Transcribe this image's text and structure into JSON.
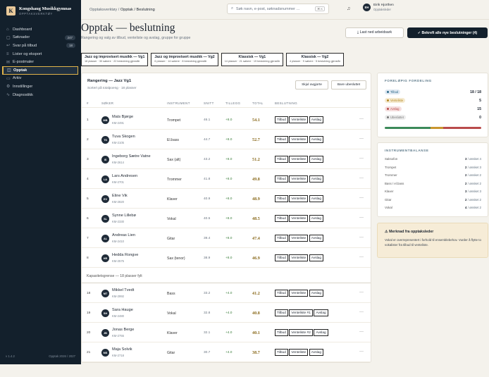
{
  "app": {
    "name": "Kongshaug Musikkgymnas",
    "sub": "OPPTAKSVERKTØY",
    "logo": "K",
    "version": "v 1.4.2",
    "period": "Opptak 2026 / 2027"
  },
  "nav": [
    {
      "icon": "⌂",
      "label": "Dashboard",
      "count": ""
    },
    {
      "icon": "▢",
      "label": "Søknader",
      "count": "247"
    },
    {
      "icon": "↩",
      "label": "Svar på tilbud",
      "count": "18"
    },
    {
      "icon": "≡",
      "label": "Lister og eksport",
      "count": ""
    },
    {
      "icon": "✉",
      "label": "E-postmaler",
      "count": ""
    },
    {
      "icon": "◫",
      "label": "Opptak",
      "count": ""
    },
    {
      "icon": "▭",
      "label": "Arkiv",
      "count": ""
    },
    {
      "icon": "⚙",
      "label": "Innstillinger",
      "count": ""
    },
    {
      "icon": "∿",
      "label": "Diagnostikk",
      "count": ""
    }
  ],
  "breadcrumb": {
    "parent": "Opptaksverktøy",
    "sep": "/",
    "current": "Opptak / Beslutning"
  },
  "search": {
    "placeholder": "Søk navn, e-post, søknadsnummer …",
    "shortcut": "⌘ K"
  },
  "user": {
    "initials": "EH",
    "name": "Eirik Hjorthen",
    "role": "Opptaksleder"
  },
  "page": {
    "title": "Opptak — beslutning",
    "subtitle": "Rangering og valg av tilbud, venteliste og avslag, gruppe for gruppe"
  },
  "actions": {
    "download": "⤓  Last ned arbeidsark",
    "confirm": "✓  Bekreft alle nye beslutninger (4)"
  },
  "tabs": [
    {
      "title": "Jazz og improvisert musikk — Vg1",
      "sub": "18 plasser · 30 søkere · 22 beslutning gjenstår"
    },
    {
      "title": "Jazz og improvisert musikk — Vg2",
      "sub": "6 plasser · 14 søkere · 8 beslutning gjenstår"
    },
    {
      "title": "Klassisk — Vg1",
      "sub": "14 plasser · 21 søkere · 19 beslutning gjenstår"
    },
    {
      "title": "Klassisk — Vg2",
      "sub": "4 plasser · 9 søkere · 5 beslutning gjenstår"
    }
  ],
  "ranking": {
    "title": "Rangering — Jazz Vg1",
    "sub": "Sortert på totalpoeng · 18 plasser",
    "hide_label": "Skjul avgjorte",
    "only_label": "Bare ubesluttet",
    "columns": {
      "num": "#",
      "applicant": "SØKER",
      "instrument": "INSTRUMENT",
      "avg": "SNITT",
      "bonus": "TILLEGG",
      "total": "TOTAL",
      "decision": "BESLUTNING"
    },
    "capacity_label": "Kapasitetsgrense — 18 plasser fylt",
    "rows": [
      {
        "n": "1",
        "ini": "MB",
        "name": "Mats Bjørge",
        "id": "KM-2491",
        "instrument": "Trompet",
        "avg": "46.1",
        "bonus": "+8.0",
        "total": "54.1",
        "b1": "Tilbud",
        "b2": "Venteliste",
        "b3": "Avslag"
      },
      {
        "n": "2",
        "ini": "TS",
        "name": "Tuva Skogen",
        "id": "KM-2105",
        "instrument": "El.bass",
        "avg": "44.7",
        "bonus": "+8.0",
        "total": "52.7",
        "b1": "Tilbud",
        "b2": "Venteliste",
        "b3": "Avslag"
      },
      {
        "n": "3",
        "ini": "IS",
        "name": "Ingeborg Sætre Vatne",
        "id": "KM-2614",
        "instrument": "Sax (alt)",
        "avg": "43.2",
        "bonus": "+8.0",
        "total": "51.2",
        "b1": "Tilbud",
        "b2": "Venteliste",
        "b3": "Avslag"
      },
      {
        "n": "4",
        "ini": "LA",
        "name": "Lars Andresen",
        "id": "KM-2701",
        "instrument": "Trommer",
        "avg": "41.8",
        "bonus": "+8.0",
        "total": "49.8",
        "b1": "Tilbud",
        "b2": "Venteliste",
        "b3": "Avslag"
      },
      {
        "n": "5",
        "ini": "EV",
        "name": "Eline Vik",
        "id": "KM-2820",
        "instrument": "Klaver",
        "avg": "40.9",
        "bonus": "+8.0",
        "total": "48.9",
        "b1": "Tilbud",
        "b2": "Venteliste",
        "b3": "Avslag"
      },
      {
        "n": "6",
        "ini": "SL",
        "name": "Synne Lillebø",
        "id": "KM-2330",
        "instrument": "Vokal",
        "avg": "40.5",
        "bonus": "+8.0",
        "total": "48.5",
        "b1": "Tilbud",
        "b2": "Venteliste",
        "b3": "Avslag"
      },
      {
        "n": "7",
        "ini": "AL",
        "name": "Andreas Lien",
        "id": "KM-2410",
        "instrument": "Gitar",
        "avg": "39.4",
        "bonus": "+8.0",
        "total": "47.4",
        "b1": "Tilbud",
        "b2": "Venteliste",
        "b3": "Avslag"
      },
      {
        "n": "8",
        "ini": "HR",
        "name": "Hedda Rongve",
        "id": "KM-2575",
        "instrument": "Sax (tenor)",
        "avg": "38.9",
        "bonus": "+8.0",
        "total": "46.9",
        "b1": "Tilbud",
        "b2": "Venteliste",
        "b3": "Avslag"
      },
      {
        "n": "18",
        "ini": "MT",
        "name": "Mikkel Tvedt",
        "id": "KM-2992",
        "instrument": "Bass",
        "avg": "33.2",
        "bonus": "+4.0",
        "total": "41.2",
        "b1": "Tilbud",
        "b2": "Venteliste",
        "b3": "Avslag"
      },
      {
        "n": "19",
        "ini": "SH",
        "name": "Sara Hauge",
        "id": "KM-2480",
        "instrument": "Vokal",
        "avg": "32.8",
        "bonus": "+4.0",
        "total": "40.8",
        "b1": "Tilbud",
        "b2": "Venteliste #1",
        "b3": "Avslag"
      },
      {
        "n": "20",
        "ini": "JB",
        "name": "Jonas Berge",
        "id": "KM-2755",
        "instrument": "Klaver",
        "avg": "32.1",
        "bonus": "+4.0",
        "total": "40.1",
        "b1": "Tilbud",
        "b2": "Venteliste #2",
        "b3": "Avslag"
      },
      {
        "n": "21",
        "ini": "MS",
        "name": "Maja Solvik",
        "id": "KM-2718",
        "instrument": "Gitar",
        "avg": "30.7",
        "bonus": "+4.0",
        "total": "38.7",
        "b1": "Tilbud",
        "b2": "Venteliste",
        "b3": "Avslag"
      }
    ]
  },
  "distribution": {
    "title": "FORELØPIG FORDELING",
    "items": [
      {
        "label": "Tilbud",
        "value": "18 / 18",
        "bg": "#dfe8f2",
        "color": "#2d6b8a",
        "amount": 18
      },
      {
        "label": "Venteliste",
        "value": "5",
        "bg": "#f5ead0",
        "color": "#b58a25",
        "amount": 5
      },
      {
        "label": "Avslag",
        "value": "15",
        "bg": "#f5dede",
        "color": "#b94b4b",
        "amount": 15
      },
      {
        "label": "Ubesluttet",
        "value": "0",
        "bg": "#ececec",
        "color": "#777777",
        "amount": 0
      }
    ],
    "bar_colors": [
      "#3c8a5a",
      "#c9962f",
      "#b94b4b"
    ]
  },
  "balance": {
    "title": "INSTRUMENTBALANSE",
    "items": [
      {
        "instrument": "Saksofon",
        "count": "3",
        "wish": "/ ønsket 4"
      },
      {
        "instrument": "Trompet",
        "count": "2",
        "wish": "/ ønsket 3"
      },
      {
        "instrument": "Trommer",
        "count": "2",
        "wish": "/ ønsket 2"
      },
      {
        "instrument": "Bass / el.bass",
        "count": "2",
        "wish": "/ ønsket 2"
      },
      {
        "instrument": "Klaver",
        "count": "3",
        "wish": "/ ønsket 3"
      },
      {
        "instrument": "Gitar",
        "count": "2",
        "wish": "/ ønsket 2"
      },
      {
        "instrument": "Vokal",
        "count": "4",
        "wish": "/ ønsket 2"
      }
    ]
  },
  "note": {
    "title": "Merknad fra opptaksleder",
    "body": "Vokal er overrepresentert i forhold til ensemblebehov. Vurder å flytte to vokalister fra tilbud til venteliste."
  },
  "colors": {
    "sidebar": "#13202c",
    "accent": "#e0b34a",
    "background": "#f4f2ec"
  }
}
